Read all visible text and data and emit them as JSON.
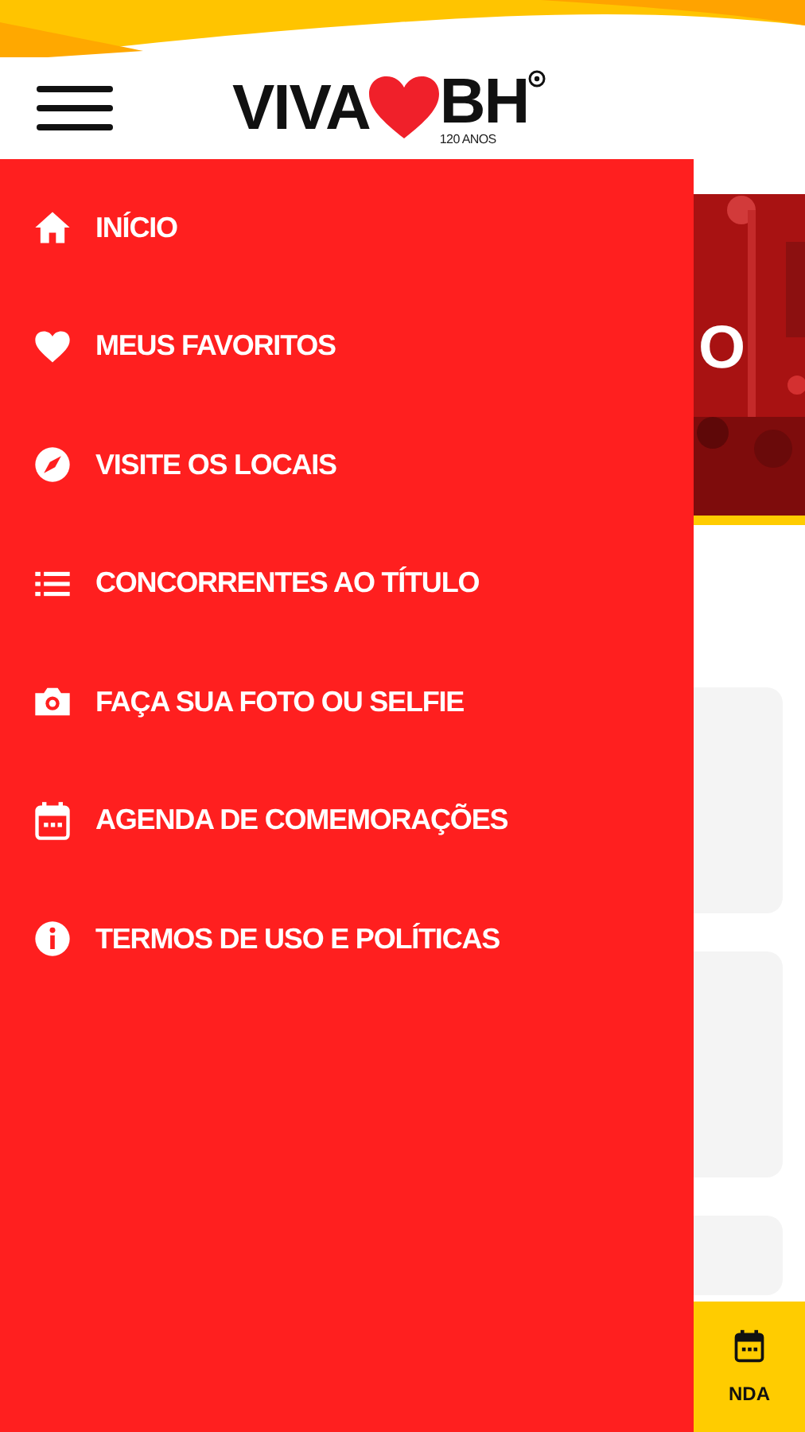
{
  "header": {
    "logo": {
      "word_1": "VIVA",
      "word_2": "BH",
      "tagline": "120 ANOS"
    }
  },
  "menu": [
    {
      "label": "INÍCIO"
    },
    {
      "label": "MEUS FAVORITOS"
    },
    {
      "label": "VISITE OS LOCAIS"
    },
    {
      "label": "CONCORRENTES AO TÍTULO"
    },
    {
      "label": "FAÇA SUA FOTO OU SELFIE"
    },
    {
      "label": "AGENDA DE COMEMORAÇÕES"
    },
    {
      "label": "TERMOS DE USO E POLÍTICAS"
    }
  ],
  "banner": {
    "text": "O"
  },
  "tab_bar": {
    "tabs": [
      {
        "label": "NDA",
        "selected": true
      }
    ]
  }
}
